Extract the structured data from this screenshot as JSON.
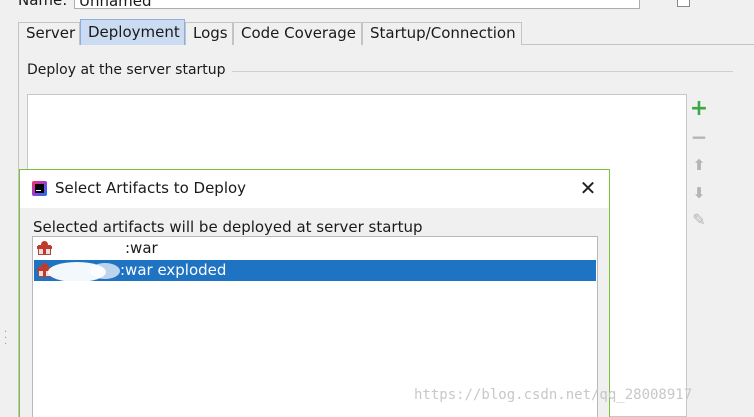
{
  "name_row": {
    "label": "Name:",
    "value": "Unnamed"
  },
  "tabs": [
    {
      "label": "Server"
    },
    {
      "label": "Deployment",
      "active": true
    },
    {
      "label": "Logs"
    },
    {
      "label": "Code Coverage"
    },
    {
      "label": "Startup/Connection"
    }
  ],
  "deploy_group": {
    "title": "Deploy at the server startup",
    "tools": [
      {
        "icon": "add-icon",
        "glyph": "+"
      },
      {
        "icon": "remove-icon",
        "glyph": "−"
      },
      {
        "icon": "move-up-icon",
        "glyph": "⬆"
      },
      {
        "icon": "move-down-icon",
        "glyph": "⬇"
      },
      {
        "icon": "edit-icon",
        "glyph": "✎"
      }
    ]
  },
  "dialog": {
    "title": "Select Artifacts to Deploy",
    "close_glyph": "✕",
    "subtitle": "Selected artifacts will be deployed at server startup",
    "artifacts": [
      {
        "label": ":war",
        "selected": false
      },
      {
        "label": ":war exploded",
        "selected": true
      }
    ]
  },
  "watermark": "https://blog.csdn.net/qq_28008917",
  "colors": {
    "accent_tab": "#cbdcf2",
    "selection": "#1e73c2",
    "add_green": "#3aa845",
    "dialog_border": "#7cbf3c"
  }
}
